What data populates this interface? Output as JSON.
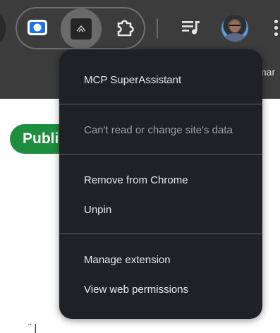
{
  "toolbar": {
    "bookmark_fragment": "mar",
    "icons": [
      "screencast-icon",
      "mcp-superassistant-icon",
      "extensions-puzzle-icon",
      "queue-music-icon",
      "profile-avatar",
      "more-vert-icon"
    ]
  },
  "page": {
    "chip_label": "Publi",
    "bottom_glyph": "¨ |"
  },
  "menu": {
    "title": "MCP SuperAssistant",
    "site_access": "Can't read or change site's data",
    "remove": "Remove from Chrome",
    "unpin": "Unpin",
    "manage": "Manage extension",
    "permissions": "View web permissions"
  },
  "colors": {
    "toolbar_bg": "#3c3c3c",
    "menu_bg": "#202124",
    "chip_green": "#1e8e3e",
    "accent_blue": "#1a73e8"
  }
}
